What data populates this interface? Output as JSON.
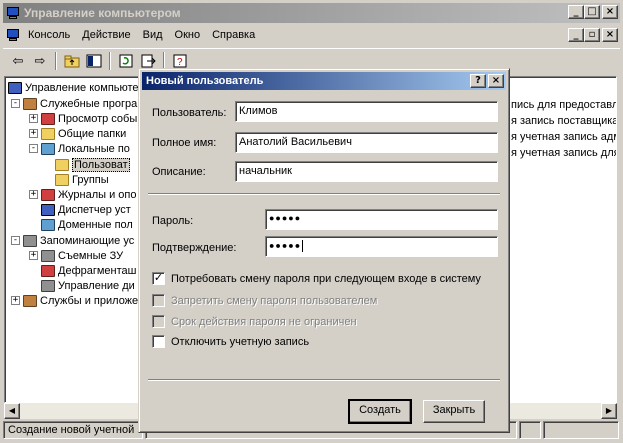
{
  "main_window": {
    "title": "Управление компьютером",
    "caption_buttons": [
      "_",
      "□",
      "×"
    ],
    "menu": [
      "Консоль",
      "Действие",
      "Вид",
      "Окно",
      "Справка"
    ],
    "mdi_buttons": [
      "_",
      "ð",
      "×"
    ]
  },
  "toolbar": {
    "back": "⇦",
    "forward": "⇨",
    "buttons": [
      "up",
      "show-hide-tree",
      "refresh",
      "export",
      "help"
    ]
  },
  "tree": {
    "items": [
      {
        "label": "Управление компьютером",
        "icon": "computer-management-icon"
      },
      {
        "label": "Служебные програ",
        "icon": "tools-icon",
        "expander": "-"
      },
      {
        "label": "Просмотр собы",
        "icon": "event-viewer-icon",
        "expander": "+"
      },
      {
        "label": "Общие папки",
        "icon": "shared-folders-icon",
        "expander": "+"
      },
      {
        "label": "Локальные по",
        "icon": "local-users-icon",
        "expander": "-"
      },
      {
        "label": "Пользоват",
        "icon": "folder-icon",
        "selected": true
      },
      {
        "label": "Группы",
        "icon": "folder-icon"
      },
      {
        "label": "Журналы и опо",
        "icon": "logs-icon",
        "expander": "+"
      },
      {
        "label": "Диспетчер уст",
        "icon": "device-manager-icon"
      },
      {
        "label": "Доменные пол",
        "icon": "domain-policy-icon"
      },
      {
        "label": "Запоминающие ус",
        "icon": "storage-icon",
        "expander": "-"
      },
      {
        "label": "Съемные ЗУ",
        "icon": "removable-storage-icon",
        "expander": "+"
      },
      {
        "label": "Дефрагменташ",
        "icon": "defrag-icon"
      },
      {
        "label": "Управление ди",
        "icon": "disk-management-icon"
      },
      {
        "label": "Службы и приложе",
        "icon": "services-icon",
        "expander": "+"
      }
    ]
  },
  "right_pane": {
    "lines": [
      "пись для предоставле",
      "я запись поставщика",
      "я учетная запись адми",
      "я учетная запись для ."
    ]
  },
  "status_bar": {
    "text": "Создание новой учетной з"
  },
  "dialog": {
    "title": "Новый пользователь",
    "help_button": "?",
    "close_button": "×",
    "fields": {
      "username_label": "Пользователь:",
      "username_value": "Климов",
      "fullname_label": "Полное имя:",
      "fullname_value": "Анатолий Васильевич",
      "description_label": "Описание:",
      "description_value": "начальник",
      "password_label": "Пароль:",
      "password_value": "●●●●●",
      "confirm_label": "Подтверждение:",
      "confirm_value": "●●●●●"
    },
    "checkboxes": [
      {
        "label": "Потребовать смену пароля при следующем входе в систему",
        "checked": true,
        "disabled": false
      },
      {
        "label": "Запретить смену пароля пользователем",
        "checked": false,
        "disabled": true
      },
      {
        "label": "Срок действия пароля не ограничен",
        "checked": false,
        "disabled": true
      },
      {
        "label": "Отключить учетную запись",
        "checked": false,
        "disabled": false
      }
    ],
    "checkmark": "✓",
    "buttons": {
      "create": "Создать",
      "close": "Закрыть"
    }
  }
}
